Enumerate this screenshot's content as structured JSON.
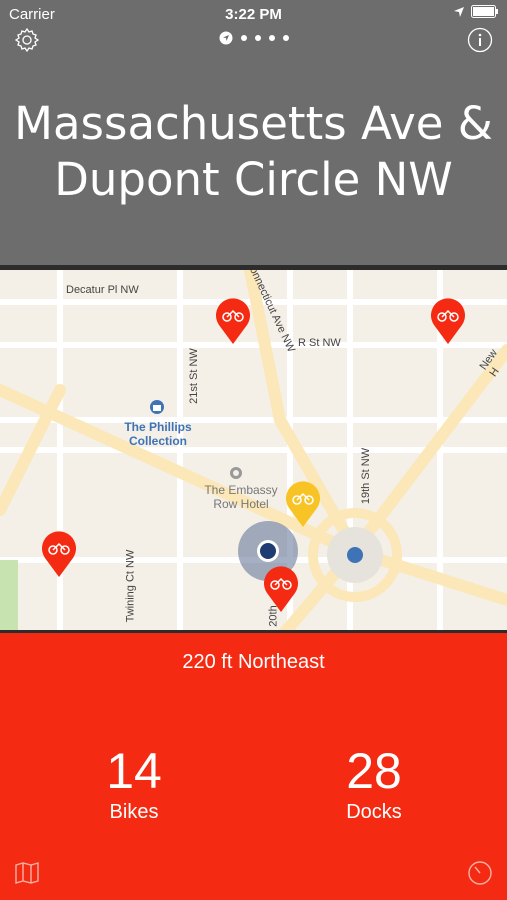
{
  "status": {
    "carrier": "Carrier",
    "time": "3:22 PM"
  },
  "header": {
    "title": "Massachusetts Ave & Dupont Circle NW"
  },
  "map": {
    "labels": {
      "decatur": "Decatur Pl NW",
      "rst": "R St NW",
      "st21": "21st St NW",
      "st19": "19th St NW",
      "twining": "Twining Ct NW",
      "conn": "Connecticut Ave NW",
      "newh": "New H",
      "st20": "20th"
    },
    "poi": {
      "phillips": "The Phillips Collection",
      "embassy": "The Embassy Row Hotel"
    }
  },
  "panel": {
    "distance": "220 ft Northeast",
    "bikes_value": "14",
    "bikes_label": "Bikes",
    "docks_value": "28",
    "docks_label": "Docks"
  },
  "colors": {
    "accent": "#f52a12",
    "header": "#6e6d6d",
    "available": "#f7c325"
  }
}
